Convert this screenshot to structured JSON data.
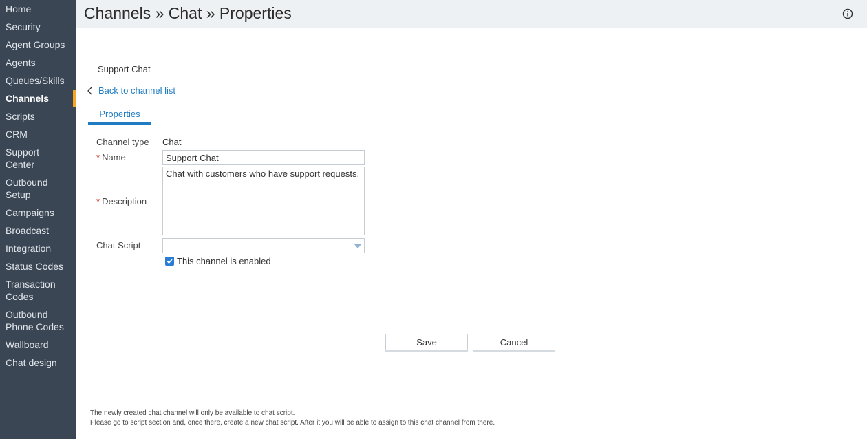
{
  "sidebar": {
    "items": [
      {
        "label": "Home"
      },
      {
        "label": "Security"
      },
      {
        "label": "Agent Groups"
      },
      {
        "label": "Agents"
      },
      {
        "label": "Queues/Skills"
      },
      {
        "label": "Channels",
        "active": true
      },
      {
        "label": "Scripts"
      },
      {
        "label": "CRM"
      },
      {
        "label": "Support",
        "label2": "Center"
      },
      {
        "label": "Outbound",
        "label2": "Setup"
      },
      {
        "label": "Campaigns"
      },
      {
        "label": "Broadcast"
      },
      {
        "label": "Integration"
      },
      {
        "label": "Status Codes"
      },
      {
        "label": "Transaction",
        "label2": "Codes"
      },
      {
        "label": "Outbound",
        "label2": "Phone Codes"
      },
      {
        "label": "Wallboard"
      },
      {
        "label": "Chat design"
      }
    ]
  },
  "header": {
    "title": "Channels » Chat » Properties",
    "info_icon": "info-icon"
  },
  "channel": {
    "name": "Support Chat",
    "back_link": "Back to channel list"
  },
  "tabs": [
    {
      "label": "Properties",
      "active": true
    }
  ],
  "form": {
    "channel_type_label": "Channel type",
    "channel_type_value": "Chat",
    "required_mark": "*",
    "name_label": "Name",
    "name_value": "Support Chat",
    "description_label": "Description",
    "description_value": "Chat with customers who have support requests.",
    "chat_script_label": "Chat Script",
    "chat_script_value": "",
    "enabled_label": "This channel is enabled",
    "enabled": true
  },
  "actions": {
    "save_label": "Save",
    "cancel_label": "Cancel"
  },
  "footer": {
    "line1": "The newly created chat channel will only be available to chat script.",
    "line2": "Please go to script section and, once there, create a new chat script. After it you will be able to assign to this chat channel from there."
  },
  "colors": {
    "sidebar_bg": "#3a4654",
    "active_marker": "#f5a623",
    "link": "#1f7cc2",
    "required": "#d0392b"
  }
}
